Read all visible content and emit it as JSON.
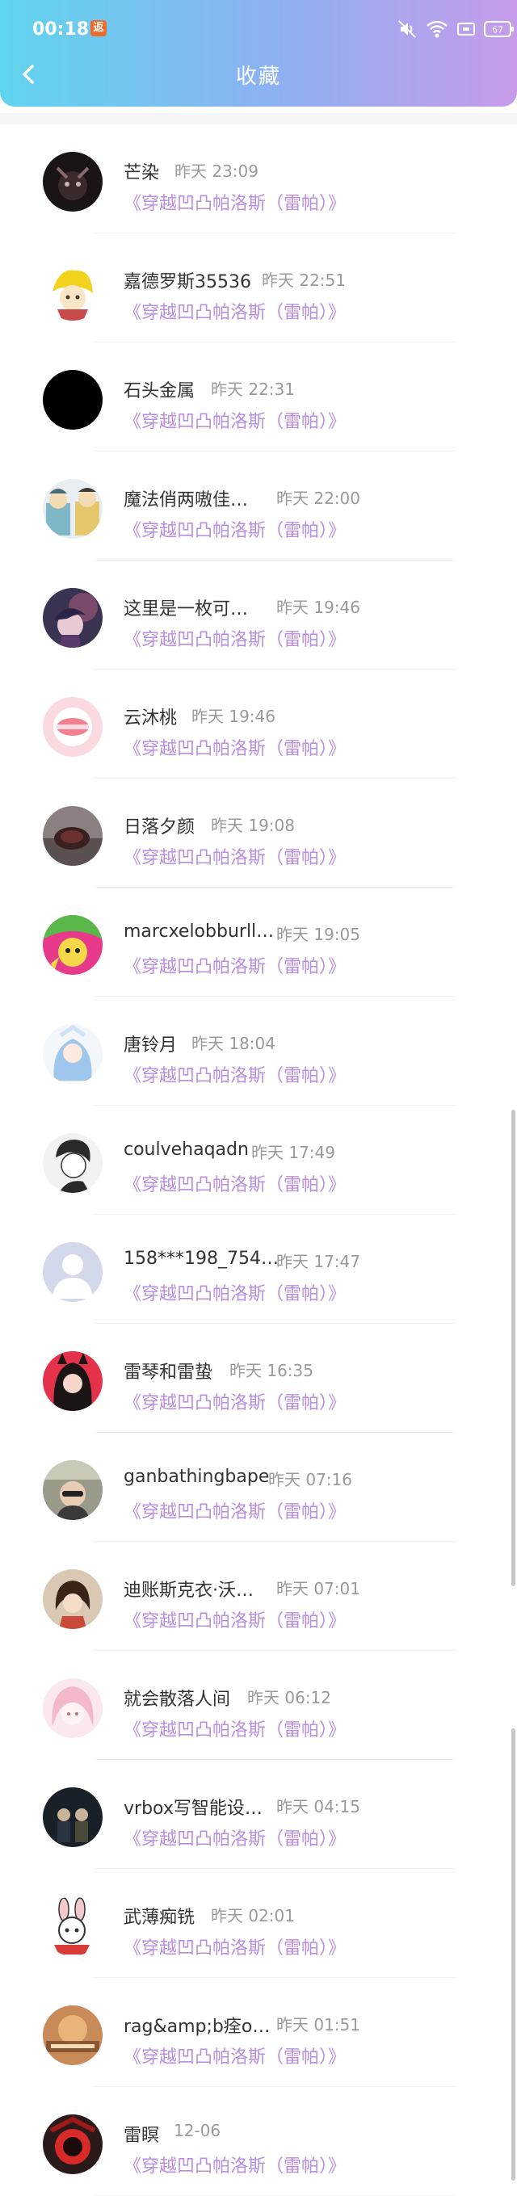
{
  "status_bar": {
    "time": "00:18",
    "notification_badge": "返",
    "battery": "67",
    "icons": [
      "mute-icon",
      "wifi-icon",
      "screen-icon",
      "battery-icon"
    ]
  },
  "header": {
    "title": "收藏",
    "back_icon": "chevron-left-icon",
    "gradient": [
      "#5fd4ee",
      "#8fb0f2",
      "#c79be9"
    ]
  },
  "accent_color": "#b88ee0",
  "items": [
    {
      "name": "芒染",
      "time": "昨天 23:09",
      "book": "《穿越凹凸帕洛斯（雷帕）》"
    },
    {
      "name": "嘉德罗斯35536",
      "time": "昨天 22:51",
      "book": "《穿越凹凸帕洛斯（雷帕）》"
    },
    {
      "name": "石头金属",
      "time": "昨天 22:31",
      "book": "《穿越凹凸帕洛斯（雷帕）》"
    },
    {
      "name": "魔法俏两嗷佳…",
      "time": "昨天 22:00",
      "book": "《穿越凹凸帕洛斯（雷帕）》"
    },
    {
      "name": "这里是一枚可…",
      "time": "昨天 19:46",
      "book": "《穿越凹凸帕洛斯（雷帕）》"
    },
    {
      "name": "云沐桃",
      "time": "昨天 19:46",
      "book": "《穿越凹凸帕洛斯（雷帕）》"
    },
    {
      "name": "日落夕颜",
      "time": "昨天 19:08",
      "book": "《穿越凹凸帕洛斯（雷帕）》"
    },
    {
      "name": "marcxelobburll…",
      "time": "昨天 19:05",
      "book": "《穿越凹凸帕洛斯（雷帕）》"
    },
    {
      "name": "唐铃月",
      "time": "昨天 18:04",
      "book": "《穿越凹凸帕洛斯（雷帕）》"
    },
    {
      "name": "coulvehaqadn",
      "time": "昨天 17:49",
      "book": "《穿越凹凸帕洛斯（雷帕）》"
    },
    {
      "name": "158***198_754…",
      "time": "昨天 17:47",
      "book": "《穿越凹凸帕洛斯（雷帕）》"
    },
    {
      "name": "雷琴和雷蛰",
      "time": "昨天 16:35",
      "book": "《穿越凹凸帕洛斯（雷帕）》"
    },
    {
      "name": "ganbathingbape",
      "time": "昨天 07:16",
      "book": "《穿越凹凸帕洛斯（雷帕）》"
    },
    {
      "name": "迪账斯克衣·沃…",
      "time": "昨天 07:01",
      "book": "《穿越凹凸帕洛斯（雷帕）》"
    },
    {
      "name": "就会散落人间",
      "time": "昨天 06:12",
      "book": "《穿越凹凸帕洛斯（雷帕）》"
    },
    {
      "name": "vrbox写智能设…",
      "time": "昨天 04:15",
      "book": "《穿越凹凸帕洛斯（雷帕）》"
    },
    {
      "name": "武薄痴铣",
      "time": "昨天 02:01",
      "book": "《穿越凹凸帕洛斯（雷帕）》"
    },
    {
      "name": "rag&amp;b痊o…",
      "time": "昨天 01:51",
      "book": "《穿越凹凸帕洛斯（雷帕）》"
    },
    {
      "name": "雷瞑",
      "time": "12-06",
      "book": "《穿越凹凸帕洛斯（雷帕）》"
    }
  ]
}
